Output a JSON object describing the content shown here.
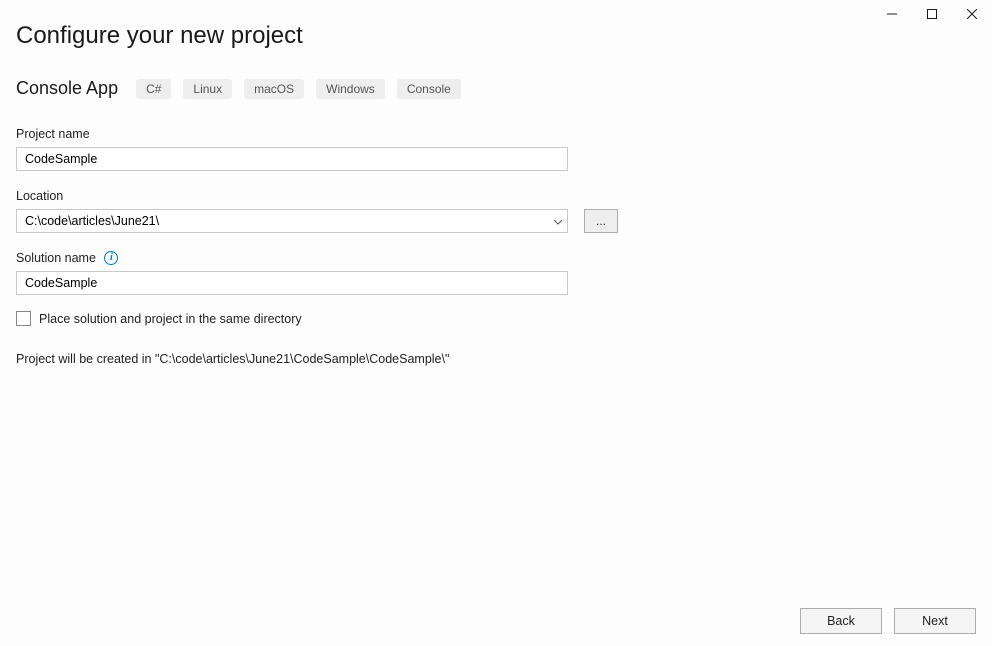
{
  "window": {
    "minimize": "minimize",
    "maximize": "maximize",
    "close": "close"
  },
  "page": {
    "title": "Configure your new project",
    "subtitle": "Console App",
    "tags": [
      "C#",
      "Linux",
      "macOS",
      "Windows",
      "Console"
    ]
  },
  "form": {
    "project_name": {
      "label": "Project name",
      "value": "CodeSample"
    },
    "location": {
      "label": "Location",
      "value": "C:\\code\\articles\\June21\\",
      "browse": "..."
    },
    "solution_name": {
      "label": "Solution name",
      "info": "i",
      "value": "CodeSample"
    },
    "same_dir": {
      "label": "Place solution and project in the same directory"
    },
    "creation_path": "Project will be created in \"C:\\code\\articles\\June21\\CodeSample\\CodeSample\\\""
  },
  "footer": {
    "back": "Back",
    "next": "Next"
  }
}
